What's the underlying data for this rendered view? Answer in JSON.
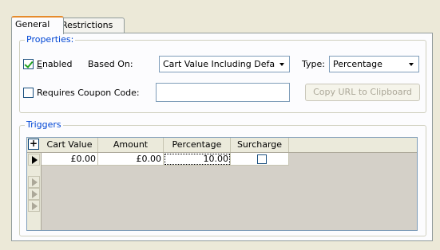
{
  "tabs": [
    {
      "label": "General",
      "active": true
    },
    {
      "label": "Restrictions",
      "active": false
    }
  ],
  "properties": {
    "legend": "Properties:",
    "enabled": {
      "label": "Enabled",
      "checked": true
    },
    "based_on": {
      "label": "Based On:",
      "value": "Cart Value Including Defau"
    },
    "type": {
      "label": "Type:",
      "value": "Percentage"
    },
    "requires_coupon": {
      "label": "Requires Coupon Code:",
      "checked": false
    },
    "coupon_code_value": "",
    "copy_url_button": "Copy URL to Clipboard"
  },
  "triggers": {
    "legend": "Triggers",
    "add_glyph": "+",
    "columns": [
      "Cart Value",
      "Amount",
      "Percentage",
      "Surcharge"
    ],
    "rows": [
      {
        "cart_value": "£0.00",
        "amount": "£0.00",
        "percentage": "10.00",
        "surcharge": false
      }
    ]
  },
  "colors": {
    "window_bg": "#ece9d8",
    "group_legend": "#0046d5",
    "tab_highlight": "#e68b2c"
  },
  "icons": {
    "add_row": "plus-icon",
    "current_row": "triangle-right-icon",
    "checkbox": "checkbox-icon"
  }
}
